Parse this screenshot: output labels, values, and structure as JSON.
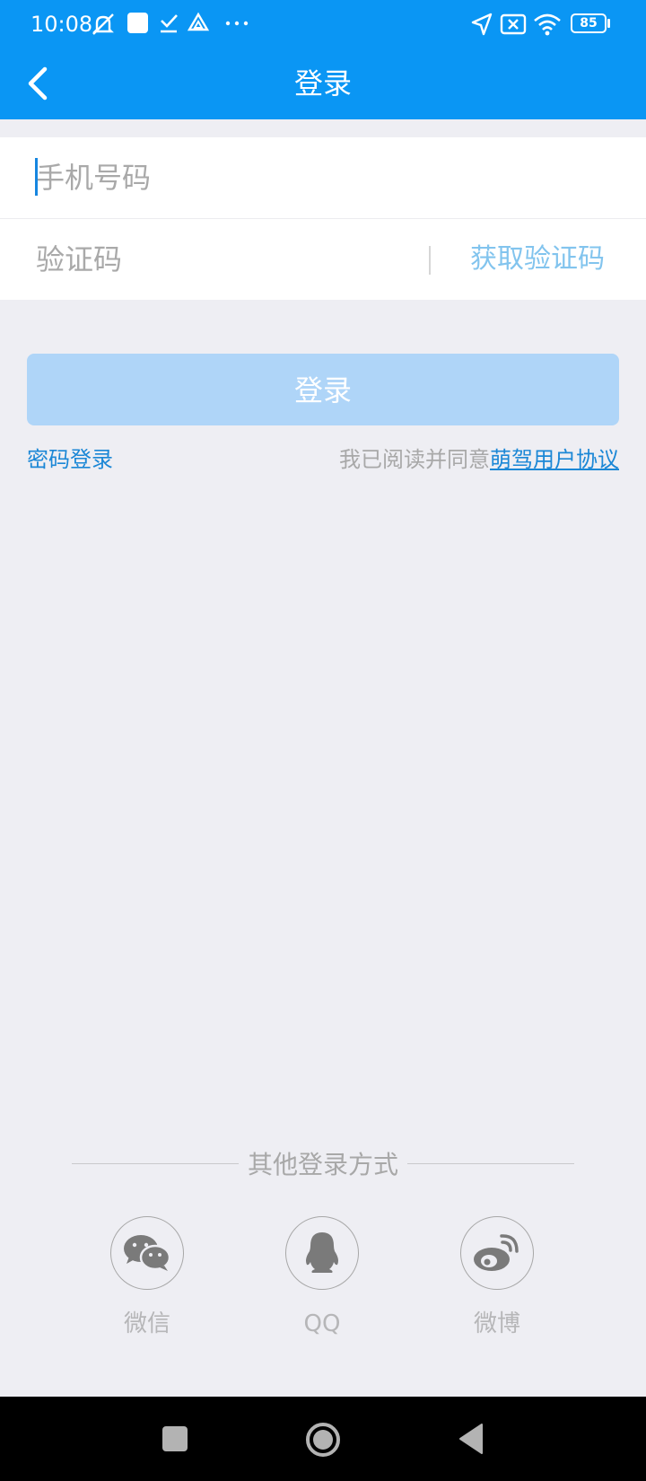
{
  "status_bar": {
    "time": "10:08",
    "battery": "85",
    "icons": [
      "notification-muted-icon",
      "square-notification-icon",
      "check-download-icon",
      "drive-icon",
      "more-dots-icon",
      "location-arrow-icon",
      "sim-off-icon",
      "wifi-icon",
      "battery-icon"
    ]
  },
  "title_bar": {
    "title": "登录",
    "back_icon": "back-arrow-icon"
  },
  "form": {
    "phone_placeholder": "手机号码",
    "phone_value": "",
    "code_placeholder": "验证码",
    "code_value": "",
    "get_code_label": "获取验证码"
  },
  "login_button_label": "登录",
  "password_login_label": "密码登录",
  "agreement": {
    "prefix": "我已阅读并同意",
    "link": "萌驾用户协议"
  },
  "other_login": {
    "title": "其他登录方式",
    "options": [
      {
        "label": "微信",
        "icon": "wechat-icon"
      },
      {
        "label": "QQ",
        "icon": "qq-icon"
      },
      {
        "label": "微博",
        "icon": "weibo-icon"
      }
    ]
  },
  "nav_bar": {
    "icons": [
      "recents-square-icon",
      "home-circle-icon",
      "back-triangle-icon"
    ]
  },
  "colors": {
    "brand_blue": "#0a96f4",
    "link_blue": "#1b87d6",
    "disabled_button": "#afd5f8",
    "background": "#eeeef3"
  }
}
